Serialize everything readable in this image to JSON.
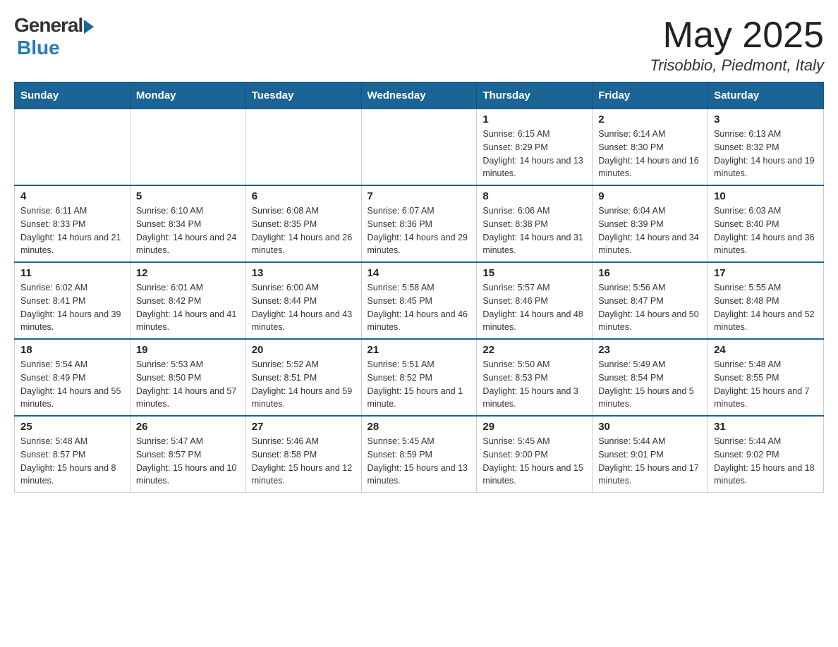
{
  "header": {
    "logo_general": "General",
    "logo_blue": "Blue",
    "month_title": "May 2025",
    "location": "Trisobbio, Piedmont, Italy"
  },
  "days_of_week": [
    "Sunday",
    "Monday",
    "Tuesday",
    "Wednesday",
    "Thursday",
    "Friday",
    "Saturday"
  ],
  "weeks": [
    [
      {
        "day": "",
        "info": ""
      },
      {
        "day": "",
        "info": ""
      },
      {
        "day": "",
        "info": ""
      },
      {
        "day": "",
        "info": ""
      },
      {
        "day": "1",
        "info": "Sunrise: 6:15 AM\nSunset: 8:29 PM\nDaylight: 14 hours and 13 minutes."
      },
      {
        "day": "2",
        "info": "Sunrise: 6:14 AM\nSunset: 8:30 PM\nDaylight: 14 hours and 16 minutes."
      },
      {
        "day": "3",
        "info": "Sunrise: 6:13 AM\nSunset: 8:32 PM\nDaylight: 14 hours and 19 minutes."
      }
    ],
    [
      {
        "day": "4",
        "info": "Sunrise: 6:11 AM\nSunset: 8:33 PM\nDaylight: 14 hours and 21 minutes."
      },
      {
        "day": "5",
        "info": "Sunrise: 6:10 AM\nSunset: 8:34 PM\nDaylight: 14 hours and 24 minutes."
      },
      {
        "day": "6",
        "info": "Sunrise: 6:08 AM\nSunset: 8:35 PM\nDaylight: 14 hours and 26 minutes."
      },
      {
        "day": "7",
        "info": "Sunrise: 6:07 AM\nSunset: 8:36 PM\nDaylight: 14 hours and 29 minutes."
      },
      {
        "day": "8",
        "info": "Sunrise: 6:06 AM\nSunset: 8:38 PM\nDaylight: 14 hours and 31 minutes."
      },
      {
        "day": "9",
        "info": "Sunrise: 6:04 AM\nSunset: 8:39 PM\nDaylight: 14 hours and 34 minutes."
      },
      {
        "day": "10",
        "info": "Sunrise: 6:03 AM\nSunset: 8:40 PM\nDaylight: 14 hours and 36 minutes."
      }
    ],
    [
      {
        "day": "11",
        "info": "Sunrise: 6:02 AM\nSunset: 8:41 PM\nDaylight: 14 hours and 39 minutes."
      },
      {
        "day": "12",
        "info": "Sunrise: 6:01 AM\nSunset: 8:42 PM\nDaylight: 14 hours and 41 minutes."
      },
      {
        "day": "13",
        "info": "Sunrise: 6:00 AM\nSunset: 8:44 PM\nDaylight: 14 hours and 43 minutes."
      },
      {
        "day": "14",
        "info": "Sunrise: 5:58 AM\nSunset: 8:45 PM\nDaylight: 14 hours and 46 minutes."
      },
      {
        "day": "15",
        "info": "Sunrise: 5:57 AM\nSunset: 8:46 PM\nDaylight: 14 hours and 48 minutes."
      },
      {
        "day": "16",
        "info": "Sunrise: 5:56 AM\nSunset: 8:47 PM\nDaylight: 14 hours and 50 minutes."
      },
      {
        "day": "17",
        "info": "Sunrise: 5:55 AM\nSunset: 8:48 PM\nDaylight: 14 hours and 52 minutes."
      }
    ],
    [
      {
        "day": "18",
        "info": "Sunrise: 5:54 AM\nSunset: 8:49 PM\nDaylight: 14 hours and 55 minutes."
      },
      {
        "day": "19",
        "info": "Sunrise: 5:53 AM\nSunset: 8:50 PM\nDaylight: 14 hours and 57 minutes."
      },
      {
        "day": "20",
        "info": "Sunrise: 5:52 AM\nSunset: 8:51 PM\nDaylight: 14 hours and 59 minutes."
      },
      {
        "day": "21",
        "info": "Sunrise: 5:51 AM\nSunset: 8:52 PM\nDaylight: 15 hours and 1 minute."
      },
      {
        "day": "22",
        "info": "Sunrise: 5:50 AM\nSunset: 8:53 PM\nDaylight: 15 hours and 3 minutes."
      },
      {
        "day": "23",
        "info": "Sunrise: 5:49 AM\nSunset: 8:54 PM\nDaylight: 15 hours and 5 minutes."
      },
      {
        "day": "24",
        "info": "Sunrise: 5:48 AM\nSunset: 8:55 PM\nDaylight: 15 hours and 7 minutes."
      }
    ],
    [
      {
        "day": "25",
        "info": "Sunrise: 5:48 AM\nSunset: 8:57 PM\nDaylight: 15 hours and 8 minutes."
      },
      {
        "day": "26",
        "info": "Sunrise: 5:47 AM\nSunset: 8:57 PM\nDaylight: 15 hours and 10 minutes."
      },
      {
        "day": "27",
        "info": "Sunrise: 5:46 AM\nSunset: 8:58 PM\nDaylight: 15 hours and 12 minutes."
      },
      {
        "day": "28",
        "info": "Sunrise: 5:45 AM\nSunset: 8:59 PM\nDaylight: 15 hours and 13 minutes."
      },
      {
        "day": "29",
        "info": "Sunrise: 5:45 AM\nSunset: 9:00 PM\nDaylight: 15 hours and 15 minutes."
      },
      {
        "day": "30",
        "info": "Sunrise: 5:44 AM\nSunset: 9:01 PM\nDaylight: 15 hours and 17 minutes."
      },
      {
        "day": "31",
        "info": "Sunrise: 5:44 AM\nSunset: 9:02 PM\nDaylight: 15 hours and 18 minutes."
      }
    ]
  ]
}
